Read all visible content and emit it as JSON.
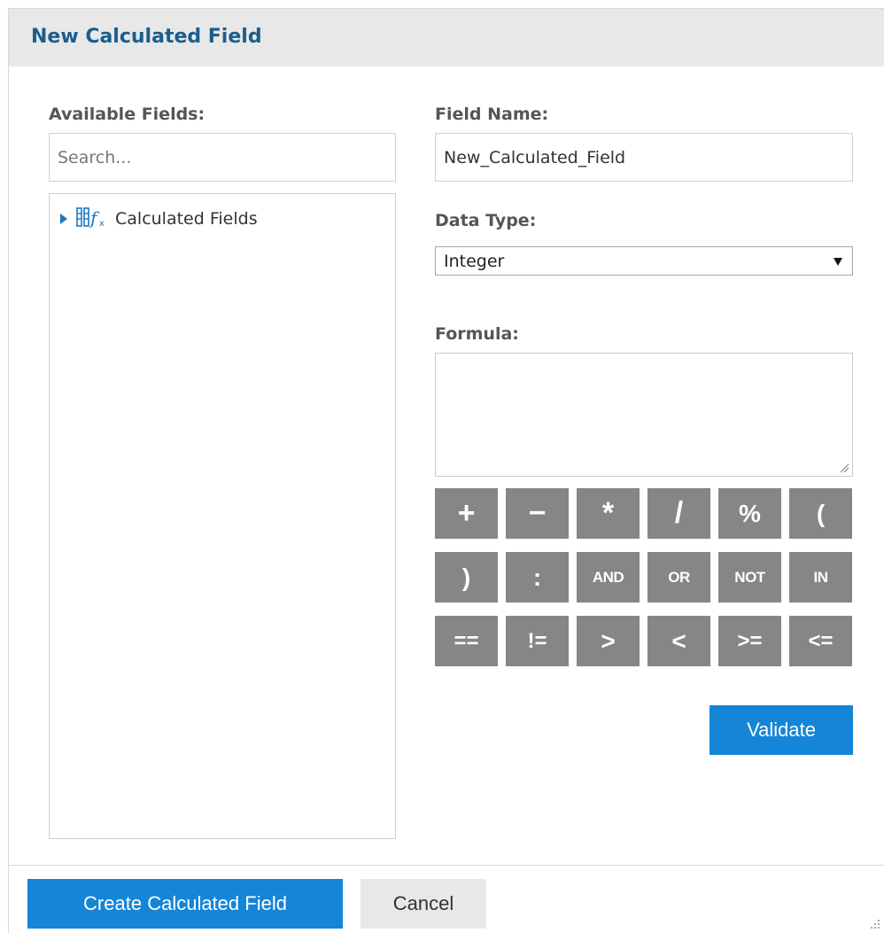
{
  "dialog": {
    "title": "New Calculated Field"
  },
  "left": {
    "available_fields_label": "Available Fields:",
    "search_placeholder": "Search...",
    "tree": [
      {
        "label": "Calculated Fields",
        "icon": "calculated-fields-icon",
        "expanded": false
      }
    ]
  },
  "right": {
    "field_name_label": "Field Name:",
    "field_name_value": "New_Calculated_Field",
    "data_type_label": "Data Type:",
    "data_type_value": "Integer",
    "formula_label": "Formula:",
    "formula_value": "",
    "operators": [
      [
        "+",
        "−",
        "*",
        "/",
        "%",
        "("
      ],
      [
        ")",
        ":",
        "AND",
        "OR",
        "NOT",
        "IN"
      ],
      [
        "==",
        "!=",
        ">",
        "<",
        ">=",
        "<="
      ]
    ],
    "validate_label": "Validate"
  },
  "footer": {
    "create_label": "Create Calculated Field",
    "cancel_label": "Cancel"
  },
  "colors": {
    "title": "#1b5e8c",
    "primary_button": "#1585d8",
    "operator_button": "#868686",
    "tree_arrow": "#1a78c2"
  }
}
